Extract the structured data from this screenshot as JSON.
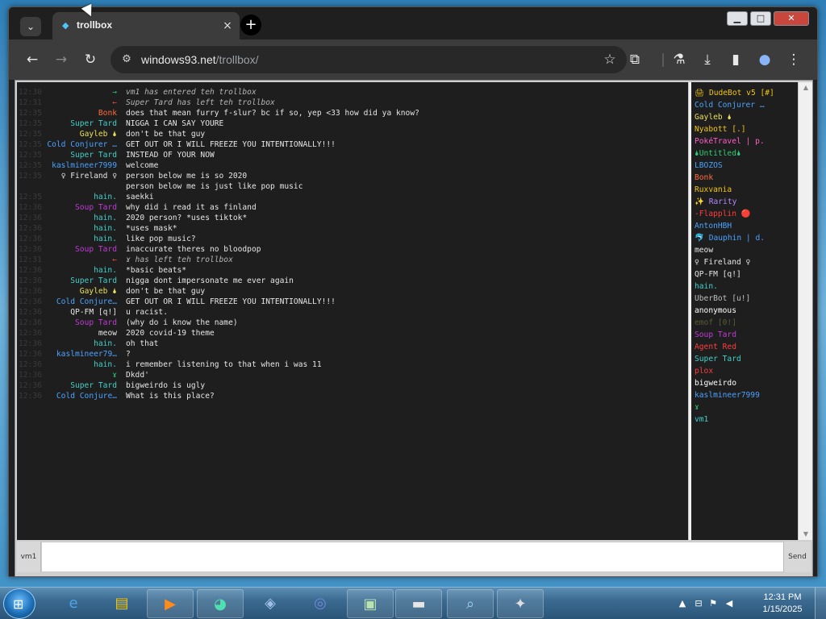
{
  "browser": {
    "tab_title": "trollbox",
    "url_domain": "windows93.net",
    "url_path": "/trollbox/",
    "tab_close": "×",
    "new_tab": "+"
  },
  "chat": {
    "messages": [
      {
        "time": "12:30",
        "nick": "→",
        "nick_color": "#2ecc71",
        "text": "vm1 has entered teh trollbox",
        "system": true
      },
      {
        "time": "12:31",
        "nick": "←",
        "nick_color": "#e74c3c",
        "text": "Super Tard has left teh trollbox",
        "system": true
      },
      {
        "time": "12:35",
        "nick": "Bonk",
        "nick_color": "#ff6b3d",
        "text": "does that mean furry f-slur? bc if so, yep <33 how did ya know?"
      },
      {
        "time": "12:35",
        "nick": "Super Tard",
        "nick_color": "#3fd0c9",
        "text": "NIGGA I CAN SAY YOURE"
      },
      {
        "time": "12:35",
        "nick": "Gayleb 🌢",
        "nick_color": "#e8e05a",
        "text": "don't be that guy"
      },
      {
        "time": "12:35",
        "nick": "Cold Conjurer …",
        "nick_color": "#4aa3ff",
        "text": "GET OUT OR I WILL FREEZE YOU INTENTIONALLY!!!"
      },
      {
        "time": "12:35",
        "nick": "Super Tard",
        "nick_color": "#3fd0c9",
        "text": "INSTEAD OF YOUR NOW"
      },
      {
        "time": "12:35",
        "nick": "kaslmineer7999",
        "nick_color": "#4aa3ff",
        "text": "welcome"
      },
      {
        "time": "12:35",
        "nick": "♀ Fireland ♀",
        "nick_color": "#e6e6e6",
        "text": "person below me is so 2020"
      },
      {
        "time": "",
        "nick": "",
        "nick_color": "#e6e6e6",
        "text": "person below me is just like pop music"
      },
      {
        "time": "12:35",
        "nick": "hain.",
        "nick_color": "#3fd0c9",
        "text": "saekki"
      },
      {
        "time": "12:36",
        "nick": "Soup Tard",
        "nick_color": "#c03bd6",
        "text": "why did i read it as finland"
      },
      {
        "time": "12:36",
        "nick": "hain.",
        "nick_color": "#3fd0c9",
        "text": "2020 person? *uses tiktok*"
      },
      {
        "time": "12:36",
        "nick": "hain.",
        "nick_color": "#3fd0c9",
        "text": "*uses mask*"
      },
      {
        "time": "12:36",
        "nick": "hain.",
        "nick_color": "#3fd0c9",
        "text": "like pop music?"
      },
      {
        "time": "12:36",
        "nick": "Soup Tard",
        "nick_color": "#c03bd6",
        "text": "inaccurate theres no bloodpop"
      },
      {
        "time": "12:31",
        "nick": "←",
        "nick_color": "#e74c3c",
        "text": "ɤ has left teh trollbox",
        "system": true
      },
      {
        "time": "12:36",
        "nick": "hain.",
        "nick_color": "#3fd0c9",
        "text": "*basic beats*"
      },
      {
        "time": "12:36",
        "nick": "Super Tard",
        "nick_color": "#3fd0c9",
        "text": "nigga dont impersonate me ever again"
      },
      {
        "time": "12:36",
        "nick": "Gayleb 🌢",
        "nick_color": "#e8e05a",
        "text": "don't be that guy"
      },
      {
        "time": "12:36",
        "nick": "Cold Conjure…",
        "nick_color": "#4aa3ff",
        "text": "GET OUT OR I WILL FREEZE YOU INTENTIONALLY!!!"
      },
      {
        "time": "12:36",
        "nick": "QP-FM [q!]",
        "nick_color": "#e6e6e6",
        "text": "u racist."
      },
      {
        "time": "12:36",
        "nick": "Soup Tard",
        "nick_color": "#c03bd6",
        "text": "(why do i know the name)"
      },
      {
        "time": "12:36",
        "nick": "meow",
        "nick_color": "#e6e6e6",
        "text": "2020 covid-19 theme"
      },
      {
        "time": "12:36",
        "nick": "hain.",
        "nick_color": "#3fd0c9",
        "text": "oh that"
      },
      {
        "time": "12:36",
        "nick": "kaslmineer79…",
        "nick_color": "#4aa3ff",
        "text": "?"
      },
      {
        "time": "12:36",
        "nick": "hain.",
        "nick_color": "#3fd0c9",
        "text": "i remember listening to that when i was 11"
      },
      {
        "time": "12:36",
        "nick": "ɤ",
        "nick_color": "#2ecc71",
        "text": "Dkdd'"
      },
      {
        "time": "12:36",
        "nick": "Super Tard",
        "nick_color": "#3fd0c9",
        "text": "bigweirdo is ugly"
      },
      {
        "time": "12:36",
        "nick": "Cold Conjure…",
        "nick_color": "#4aa3ff",
        "text": "What is this place?"
      }
    ]
  },
  "users": [
    {
      "name": "🖨 DudeBot v5 [#]",
      "color": "#f1c40f"
    },
    {
      "name": "Cold Conjurer …",
      "color": "#4aa3ff"
    },
    {
      "name": "Gayleb 🌢",
      "color": "#e8e05a"
    },
    {
      "name": "Nyabott [.]",
      "color": "#f1c40f"
    },
    {
      "name": "PokéTravel | p.",
      "color": "#ff5ec4"
    },
    {
      "name": "🌢Untitled🌢",
      "color": "#2ecc71"
    },
    {
      "name": "LBOZOS",
      "color": "#4aa3ff"
    },
    {
      "name": "Bonk",
      "color": "#ff6b3d"
    },
    {
      "name": "Ruxvania",
      "color": "#f1c40f"
    },
    {
      "name": "✨ Rarity",
      "color": "#b388ff"
    },
    {
      "name": "-Flapplin 🔴",
      "color": "#ff3d3d"
    },
    {
      "name": "AntonHBH",
      "color": "#4aa3ff"
    },
    {
      "name": "🐬 Dauphin | d.",
      "color": "#4aa3ff"
    },
    {
      "name": "meow",
      "color": "#e6e6e6"
    },
    {
      "name": "♀ Fireland ♀",
      "color": "#e6e6e6"
    },
    {
      "name": "QP-FM [q!]",
      "color": "#e6e6e6"
    },
    {
      "name": "hain.",
      "color": "#3fd0c9"
    },
    {
      "name": "UberBot [u!]",
      "color": "#bdbdbd"
    },
    {
      "name": "anonymous",
      "color": "#ffffff"
    },
    {
      "name": "emof [0!]",
      "color": "#5a5a38"
    },
    {
      "name": "Soup Tard",
      "color": "#c03bd6"
    },
    {
      "name": "Agent Red",
      "color": "#ff3d3d"
    },
    {
      "name": "Super Tard",
      "color": "#3fd0c9"
    },
    {
      "name": "plox",
      "color": "#ff3d3d"
    },
    {
      "name": "bigweirdo",
      "color": "#ffffff"
    },
    {
      "name": "kaslmineer7999",
      "color": "#4aa3ff"
    },
    {
      "name": "ɤ",
      "color": "#2ecc71"
    },
    {
      "name": "vm1",
      "color": "#3fd0c9"
    }
  ],
  "input": {
    "nick_label": "vm1",
    "value": "",
    "send_label": "Send"
  },
  "taskbar": {
    "time": "12:31 PM",
    "date": "1/15/2025"
  }
}
